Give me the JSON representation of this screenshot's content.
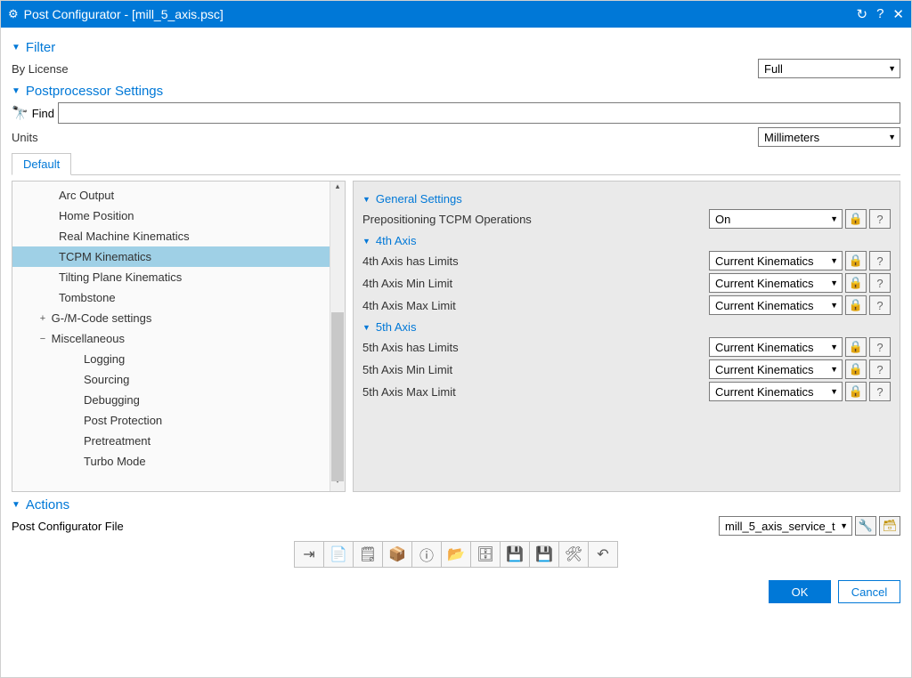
{
  "title": "Post Configurator - [mill_5_axis.psc]",
  "filter": {
    "header": "Filter",
    "by_license": "By License",
    "value": "Full"
  },
  "pp": {
    "header": "Postprocessor Settings",
    "find_label": "Find",
    "units_label": "Units",
    "units_value": "Millimeters",
    "tab_default": "Default"
  },
  "tree": {
    "arc_output": "Arc Output",
    "home_position": "Home Position",
    "real_machine": "Real Machine Kinematics",
    "tcpm": "TCPM Kinematics",
    "tilting": "Tilting Plane Kinematics",
    "tombstone": "Tombstone",
    "gm": "G-/M-Code settings",
    "misc": "Miscellaneous",
    "logging": "Logging",
    "sourcing": "Sourcing",
    "debugging": "Debugging",
    "post_protection": "Post Protection",
    "pretreatment": "Pretreatment",
    "turbo": "Turbo Mode"
  },
  "props": {
    "general_hdr": "General Settings",
    "prepositioning": "Prepositioning TCPM Operations",
    "prepositioning_val": "On",
    "axis4_hdr": "4th Axis",
    "a4_limits": "4th Axis has Limits",
    "a4_min": "4th Axis Min Limit",
    "a4_max": "4th Axis Max Limit",
    "axis5_hdr": "5th Axis",
    "a5_limits": "5th Axis has Limits",
    "a5_min": "5th Axis Min Limit",
    "a5_max": "5th Axis Max Limit",
    "ck": "Current Kinematics"
  },
  "actions": {
    "header": "Actions",
    "file_label": "Post Configurator File",
    "file_value": "mill_5_axis_service_t…"
  },
  "footer": {
    "ok": "OK",
    "cancel": "Cancel"
  }
}
